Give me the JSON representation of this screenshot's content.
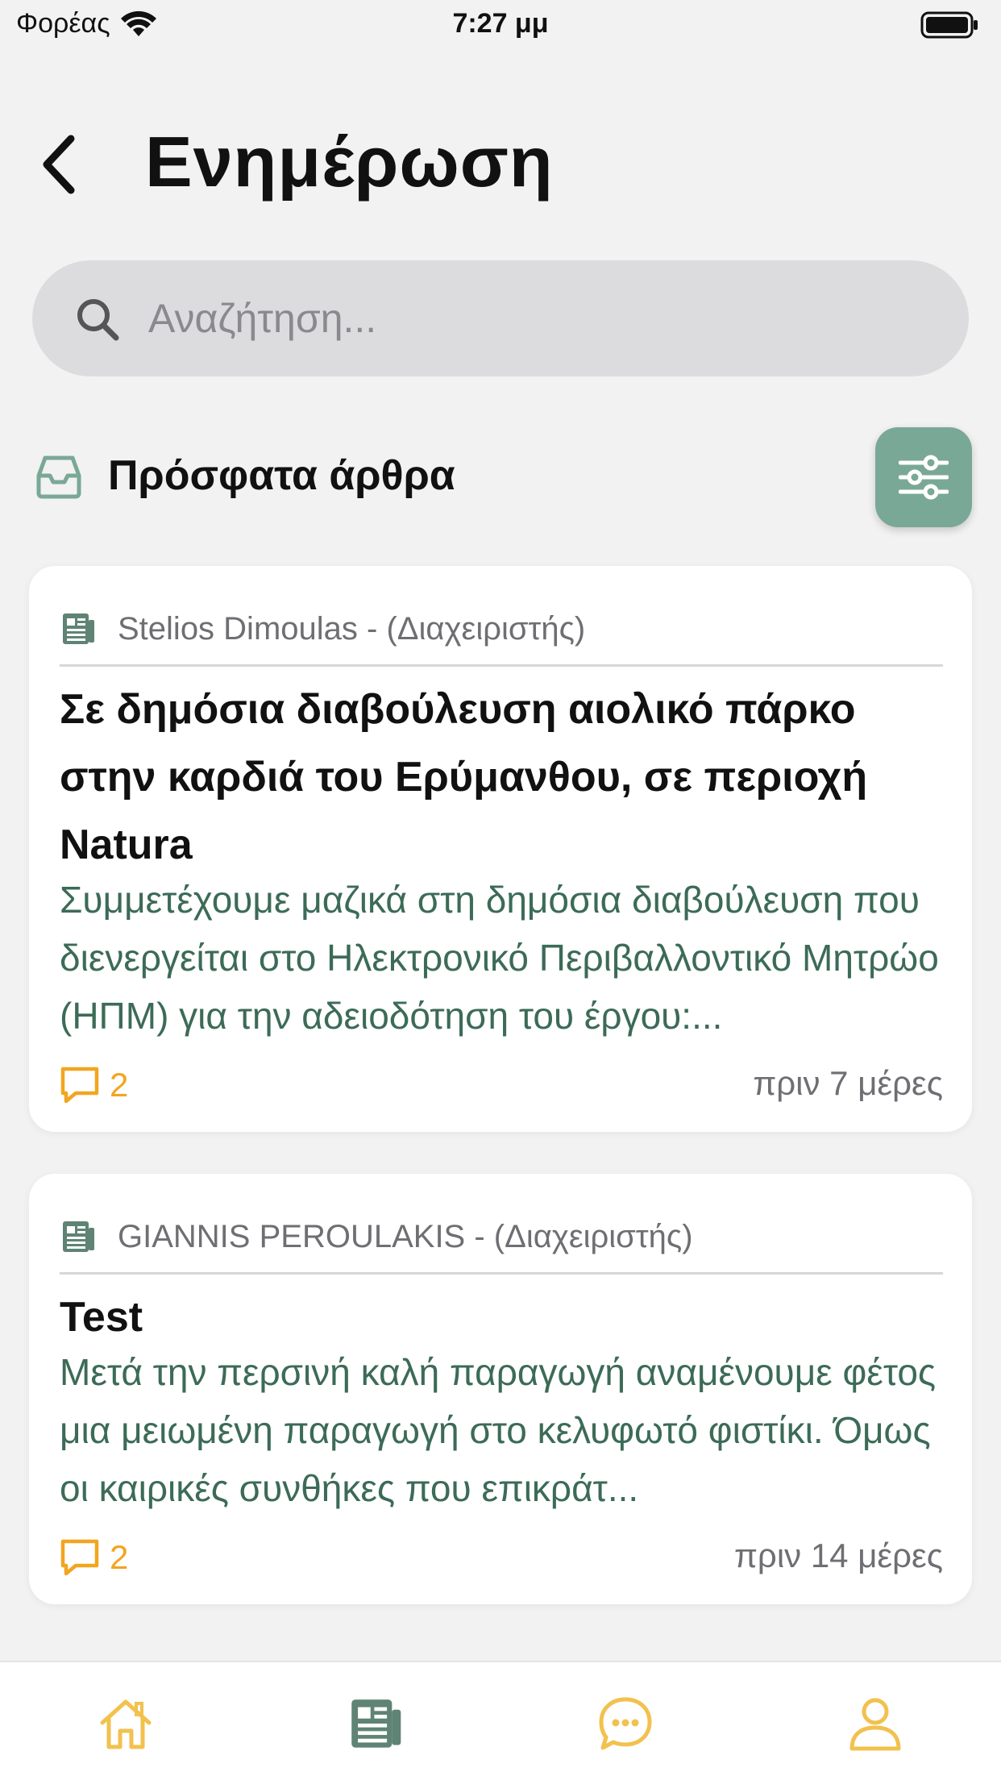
{
  "status_bar": {
    "carrier": "Φορέας",
    "time": "7:27 μμ"
  },
  "header": {
    "title": "Ενημέρωση"
  },
  "search": {
    "placeholder": "Αναζήτηση..."
  },
  "section": {
    "title": "Πρόσφατα άρθρα"
  },
  "articles": [
    {
      "author": "Stelios Dimoulas - (Διαχειριστής)",
      "title": "Σε δημόσια διαβούλευση αιολικό πάρκο στην καρδιά του Ερύμανθου, σε περιοχή Natura",
      "excerpt": "Συμμετέχουμε μαζικά στη δημόσια διαβούλευση που διενεργείται στο Ηλεκτρονικό Περιβαλλοντικό Μητρώο (ΗΠΜ) για την αδειοδότηση του έργου:...",
      "comments": "2",
      "time": "πριν 7 μέρες"
    },
    {
      "author": "GIANNIS PEROULAKIS - (Διαχειριστής)",
      "title": "Test",
      "excerpt": "Μετά την περσινή καλή παραγωγή αναμένουμε φέτος μια μειωμένη παραγωγή στο κελυφωτό φιστίκι. Όμως οι καιρικές συνθήκες που επικράτ...",
      "comments": "2",
      "time": "πριν 14 μέρες"
    }
  ],
  "colors": {
    "accent_green": "#7aa897",
    "excerpt_green": "#3c6b57",
    "tab_inactive": "#f2c14e",
    "tab_active": "#5f8374",
    "comment_orange": "#f2a51f"
  },
  "tabs": [
    {
      "icon": "home-icon",
      "active": false
    },
    {
      "icon": "newspaper-icon",
      "active": true
    },
    {
      "icon": "chat-icon",
      "active": false
    },
    {
      "icon": "user-icon",
      "active": false
    }
  ]
}
